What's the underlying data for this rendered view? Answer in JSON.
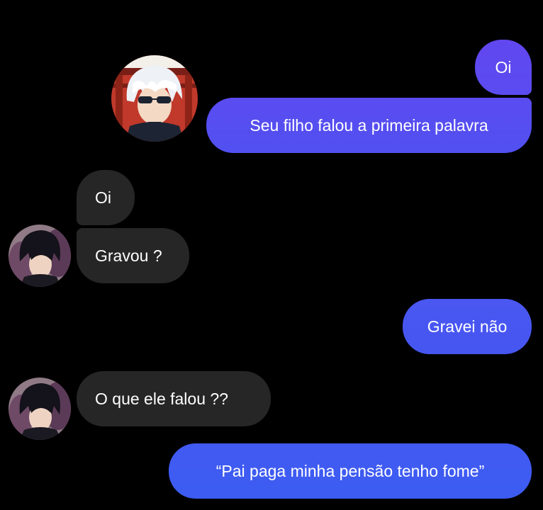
{
  "theme": {
    "background": "#000000",
    "incoming_bubble": "#262626",
    "outgoing_gradient_top": "#6147f0",
    "outgoing_gradient_bottom": "#3f5cf2",
    "text": "#ffffff"
  },
  "conversation": {
    "messages": [
      {
        "id": "m1",
        "direction": "outgoing",
        "text": "Oi"
      },
      {
        "id": "m2",
        "direction": "outgoing",
        "text": "Seu filho falou a primeira palavra"
      },
      {
        "id": "m3",
        "direction": "incoming",
        "text": "Oi"
      },
      {
        "id": "m4",
        "direction": "incoming",
        "text": "Gravou ?"
      },
      {
        "id": "m5",
        "direction": "outgoing",
        "text": "Gravei não"
      },
      {
        "id": "m6",
        "direction": "incoming",
        "text": "O que ele falou ??"
      },
      {
        "id": "m7",
        "direction": "outgoing",
        "text": "“Pai paga minha pensão tenho fome”"
      }
    ],
    "avatars": {
      "sender": "white-haired-character-avatar",
      "receiver": "dark-haired-character-avatar"
    }
  }
}
